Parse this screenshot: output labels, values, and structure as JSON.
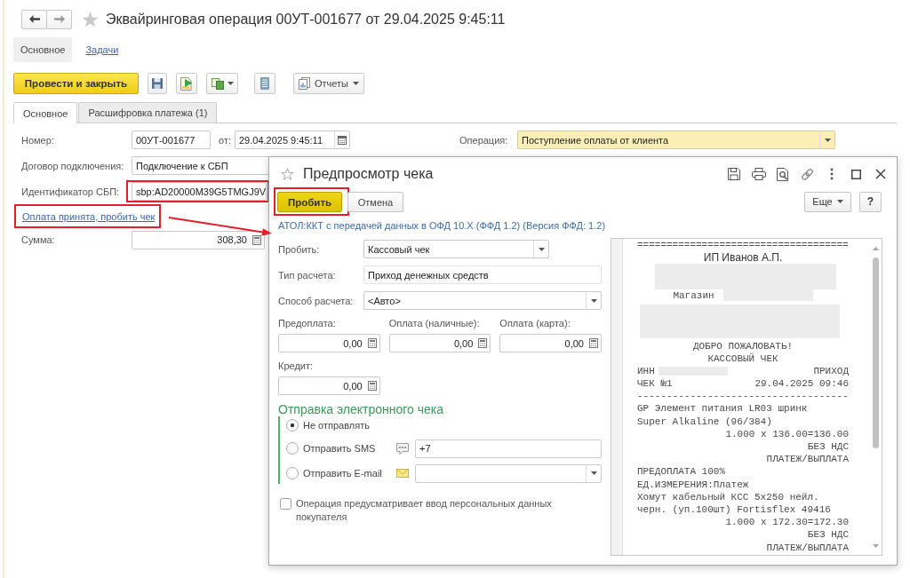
{
  "window": {
    "title": "Эквайринговая операция 00УТ-001677 от 29.04.2025 9:45:11"
  },
  "sections": [
    {
      "label": "Основное",
      "selected": true
    },
    {
      "label": "Задачи",
      "selected": false
    }
  ],
  "toolbar": {
    "primary_button": "Провести и закрыть",
    "reports_button": "Отчеты"
  },
  "tabs": [
    {
      "label": "Основное",
      "selected": true
    },
    {
      "label": "Расшифровка платежа (1)",
      "selected": false
    }
  ],
  "form": {
    "number": {
      "label": "Номер:",
      "value": "00УТ-001677"
    },
    "date": {
      "label": "от:",
      "value": "29.04.2025 9:45:11"
    },
    "operation": {
      "label": "Операция:",
      "value": "Поступление оплаты от клиента"
    },
    "contract": {
      "label": "Договор подключения:",
      "value": "Подключение к СБП"
    },
    "sbp_id": {
      "label": "Идентификатор СБП:",
      "value": "sbp:AD20000M39G5TMGJ9V",
      "highlighted": true
    },
    "action_link": {
      "label": "Оплата принята, пробить чек",
      "highlighted": true
    },
    "amount": {
      "label": "Сумма:",
      "value": "308,30"
    }
  },
  "dialog": {
    "title": "Предпросмотр чека",
    "buttons": [
      {
        "label": "Пробить",
        "kind": "primary",
        "highlighted": true
      },
      {
        "label": "Отмена",
        "kind": "default",
        "highlighted": false
      }
    ],
    "more_button": "Еще",
    "help_button": "?",
    "device_link": "АТОЛ:ККТ с передачей данных в ОФД 10.X (ФФД 1.2) (Версия ФФД: 1.2)",
    "fields": [
      {
        "kind": "select",
        "label": "Пробить:",
        "value": "Кассовый чек"
      },
      {
        "kind": "text",
        "label": "Тип расчета:",
        "value": "Приход денежных средств"
      },
      {
        "kind": "select",
        "label": "Способ расчета:",
        "value": "<Авто>"
      }
    ],
    "payments": [
      {
        "label": "Предоплата:",
        "value": "0,00"
      },
      {
        "label": "Оплата (наличные):",
        "value": "0,00"
      },
      {
        "label": "Оплата (карта):",
        "value": "0,00"
      },
      {
        "label": "Кредит:",
        "value": "0,00"
      }
    ],
    "electronic_receipt": {
      "title": "Отправка электронного чека",
      "options": [
        {
          "kind": "none",
          "label": "Не отправлять",
          "selected": true
        },
        {
          "kind": "sms",
          "label": "Отправить SMS",
          "selected": false,
          "value": "+7"
        },
        {
          "kind": "email",
          "label": "Отправить E-mail",
          "selected": false
        }
      ]
    },
    "personal_data": {
      "label": "Операция предусматривает ввод персональных данных покупателя",
      "checked": false
    },
    "receipt": {
      "lines": [
        {
          "kind": "left",
          "text": "===================================="
        },
        {
          "kind": "heading",
          "text": "ИП Иванов А.П."
        },
        {
          "kind": "redacted"
        },
        {
          "kind": "text_redacted",
          "text": "Магазин"
        },
        {
          "kind": "redacted_tall"
        },
        {
          "kind": "center",
          "text": "ДОБРО ПОЖАЛОВАТЬ!"
        },
        {
          "kind": "center",
          "text": "КАССОВЫЙ ЧЕК"
        },
        {
          "kind": "pair",
          "left": "ИНН",
          "right": "ПРИХОД",
          "redacted": true
        },
        {
          "kind": "pair",
          "left": "ЧЕК №1",
          "right": "29.04.2025 09:46",
          "redacted": false
        },
        {
          "kind": "left",
          "text": "------------------------------------"
        },
        {
          "kind": "left",
          "text": "GP Элемент питания LR03 шринк"
        },
        {
          "kind": "left",
          "text": "Super Alkaline (96/384)"
        },
        {
          "kind": "right",
          "text": "1.000 x 136.00=136.00"
        },
        {
          "kind": "right",
          "text": "БЕЗ НДС"
        },
        {
          "kind": "right",
          "text": "ПЛАТЕЖ/ВЫПЛАТА"
        },
        {
          "kind": "left",
          "text": "ПРЕДОПЛАТА 100%"
        },
        {
          "kind": "left",
          "text": "ЕД.ИЗМЕРЕНИЯ:Платеж"
        },
        {
          "kind": "left",
          "text": "Хомут кабельный КСС 5x250 нейл."
        },
        {
          "kind": "left",
          "text": "черн. (уп.100шт) Fortisflex 49416"
        },
        {
          "kind": "right",
          "text": "1.000 x 172.30=172.30"
        },
        {
          "kind": "right",
          "text": "БЕЗ НДС"
        },
        {
          "kind": "right",
          "text": "ПЛАТЕЖ/ВЫПЛАТА"
        }
      ]
    }
  }
}
